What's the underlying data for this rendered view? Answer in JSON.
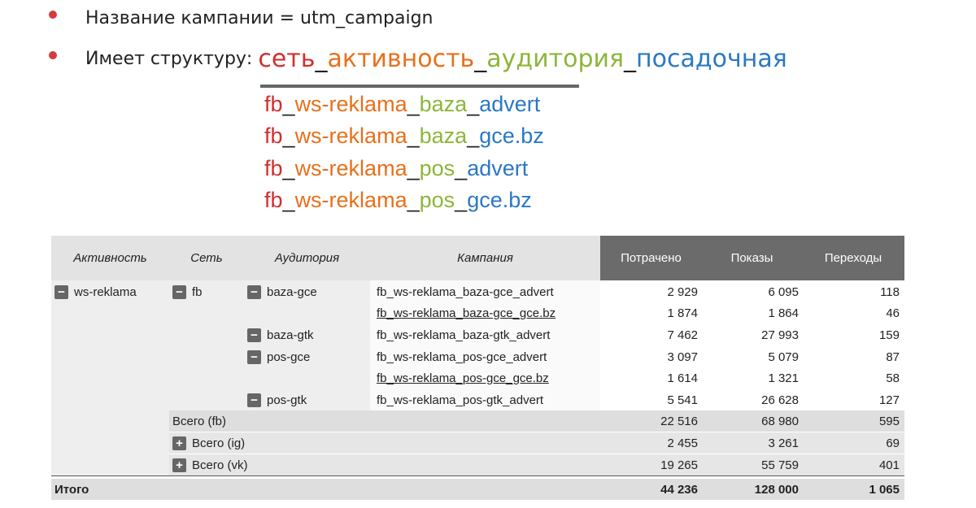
{
  "bullets": {
    "line1": "Название кампании = utm_campaign",
    "line2_prefix": "Имеет структуру: ",
    "structure": {
      "net": "сеть",
      "sep": "_",
      "activity": "активность",
      "audience": "аудитория",
      "landing": "посадочная"
    }
  },
  "examples": [
    {
      "net": "fb",
      "activity": "ws-reklama",
      "audience": "baza",
      "landing": "advert"
    },
    {
      "net": "fb",
      "activity": "ws-reklama",
      "audience": "baza",
      "landing": "gce.bz"
    },
    {
      "net": "fb",
      "activity": "ws-reklama",
      "audience": "pos",
      "landing": "advert"
    },
    {
      "net": "fb",
      "activity": "ws-reklama",
      "audience": "pos",
      "landing": "gce.bz"
    }
  ],
  "colors": {
    "net": "#d32f2f",
    "activity": "#e8701a",
    "audience": "#8db53a",
    "landing": "#2b78c5",
    "bullet": "#d63a3a"
  },
  "table": {
    "headers": {
      "activity": "Активность",
      "net": "Сеть",
      "audience": "Аудитория",
      "campaign": "Кампания",
      "spent": "Потрачено",
      "impressions": "Показы",
      "clicks": "Переходы"
    },
    "activity": "ws-reklama",
    "net": "fb",
    "audiences": {
      "a0": "baza-gce",
      "a1": "baza-gtk",
      "a2": "pos-gce",
      "a3": "pos-gtk"
    },
    "rows": [
      {
        "campaign": "fb_ws-reklama_baza-gce_advert",
        "spent": "2 929",
        "impressions": "6 095",
        "clicks": "118"
      },
      {
        "campaign": "fb_ws-reklama_baza-gce_gce.bz",
        "spent": "1 874",
        "impressions": "1 864",
        "clicks": "46"
      },
      {
        "campaign": "fb_ws-reklama_baza-gtk_advert",
        "spent": "7 462",
        "impressions": "27 993",
        "clicks": "159"
      },
      {
        "campaign": "fb_ws-reklama_pos-gce_advert",
        "spent": "3 097",
        "impressions": "5 079",
        "clicks": "87"
      },
      {
        "campaign": "fb_ws-reklama_pos-gce_gce.bz",
        "spent": "1 614",
        "impressions": "1 321",
        "clicks": "58"
      },
      {
        "campaign": "fb_ws-reklama_pos-gtk_advert",
        "spent": "5 541",
        "impressions": "26 628",
        "clicks": "127"
      }
    ],
    "subtotals": [
      {
        "label": "Всего (fb)",
        "spent": "22 516",
        "impressions": "68 980",
        "clicks": "595"
      },
      {
        "label": "Всего (ig)",
        "spent": "2 455",
        "impressions": "3 261",
        "clicks": "69"
      },
      {
        "label": "Всего (vk)",
        "spent": "19 265",
        "impressions": "55 759",
        "clicks": "401"
      }
    ],
    "total": {
      "label": "Итого",
      "spent": "44 236",
      "impressions": "128 000",
      "clicks": "1 065"
    },
    "collapse_glyph": "−",
    "expand_glyph": "+"
  }
}
